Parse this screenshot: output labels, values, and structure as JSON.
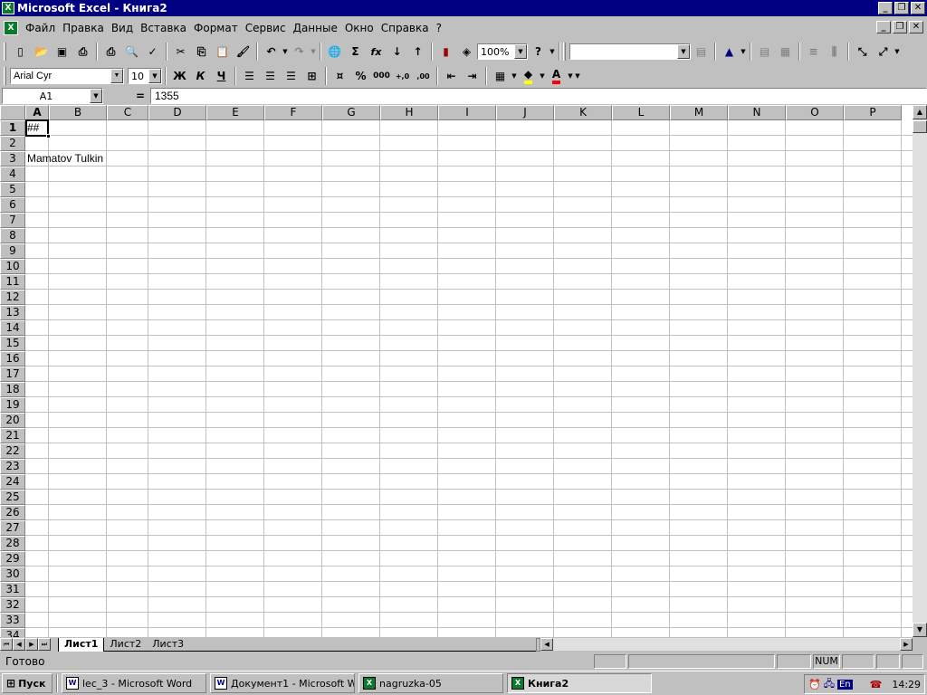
{
  "window": {
    "title": "Microsoft Excel - Книга2",
    "app_icon": "excel-icon"
  },
  "menu": {
    "items": [
      "Файл",
      "Правка",
      "Вид",
      "Вставка",
      "Формат",
      "Сервис",
      "Данные",
      "Окно",
      "Справка"
    ],
    "help_glyph": "?"
  },
  "toolbar_standard": {
    "zoom": "100%",
    "buttons": [
      "new-icon",
      "open-icon",
      "save-icon",
      "print-preview-icon",
      "print-icon",
      "preview-icon",
      "spelling-icon",
      "cut-icon",
      "copy-icon",
      "paste-icon",
      "format-painter-icon",
      "undo-icon",
      "redo-icon",
      "hyperlink-icon",
      "autosum-icon",
      "function-icon",
      "sort-asc-icon",
      "sort-desc-icon",
      "chart-wizard-icon",
      "map-icon",
      "help-icon"
    ],
    "labels": {
      "autosum": "Σ",
      "function": "fx"
    }
  },
  "toolbar_format": {
    "font": "Arial Cyr",
    "size": "10",
    "bold": "Ж",
    "italic": "К",
    "underline": "Ч",
    "percent": "%",
    "thousands": "000",
    "inc_decimal": "+,0",
    "dec_decimal": ",00"
  },
  "formula_bar": {
    "name_box": "A1",
    "equals": "=",
    "content": "1355"
  },
  "columns": [
    "A",
    "B",
    "C",
    "D",
    "E",
    "F",
    "G",
    "H",
    "I",
    "J",
    "K",
    "L",
    "M",
    "N",
    "O",
    "P"
  ],
  "rows": [
    "1",
    "2",
    "3",
    "4",
    "5",
    "6",
    "7",
    "8",
    "9",
    "10",
    "11",
    "12",
    "13",
    "14",
    "15",
    "16",
    "17",
    "18",
    "19",
    "20",
    "21",
    "22",
    "23",
    "24",
    "25",
    "26",
    "27",
    "28",
    "29",
    "30",
    "31",
    "32",
    "33",
    "34"
  ],
  "cells": {
    "A1": "##",
    "A3": "Mamatov Tulkin"
  },
  "sheets": {
    "tabs": [
      "Лист1",
      "Лист2",
      "Лист3"
    ],
    "active": "Лист1"
  },
  "status": {
    "ready": "Готово",
    "num": "NUM"
  },
  "taskbar": {
    "start": "Пуск",
    "buttons": [
      {
        "label": "lec_3 - Microsoft Word",
        "icon": "word-icon"
      },
      {
        "label": "Документ1 - Microsoft W...",
        "icon": "word-icon"
      },
      {
        "label": "nagruzka-05",
        "icon": "excel-icon"
      },
      {
        "label": "Книга2",
        "icon": "excel-icon"
      }
    ],
    "lang": "En",
    "clock": "14:29"
  },
  "colors": {
    "title_bar": "#000080",
    "grid": "#c0c0c0",
    "font_color": "#ff0000",
    "fill_color": "#ffff00"
  }
}
